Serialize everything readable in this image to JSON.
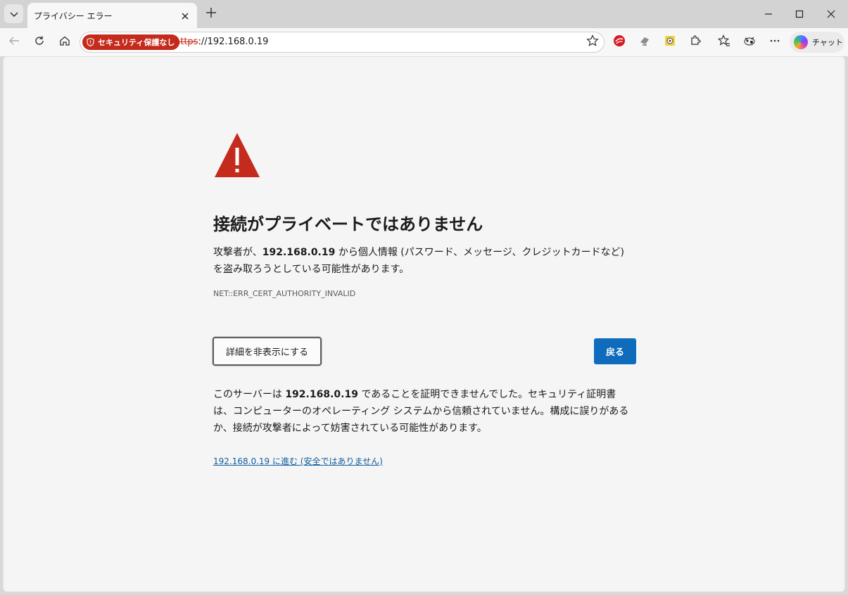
{
  "tab": {
    "title": "プライバシー エラー"
  },
  "omnibox": {
    "security_chip": "セキュリティ保護なし",
    "url_scheme": "https",
    "url_rest": "://192.168.0.19"
  },
  "toolbar": {
    "chat_label": "チャット"
  },
  "colors": {
    "danger": "#c42b1c",
    "primary": "#0f6cbd",
    "link": "#115ea3"
  },
  "error_page": {
    "heading": "接続がプライベートではありません",
    "desc_prefix": "攻撃者が、",
    "desc_host": "192.168.0.19",
    "desc_suffix": " から個人情報 (パスワード、メッセージ、クレジットカードなど) を盗み取ろうとしている可能性があります。",
    "error_code": "NET::ERR_CERT_AUTHORITY_INVALID",
    "details_button": "詳細を非表示にする",
    "back_button": "戻る",
    "explain_prefix": "このサーバーは ",
    "explain_host": "192.168.0.19",
    "explain_suffix": " であることを証明できませんでした。セキュリティ証明書は、コンピューターのオペレーティング システムから信頼されていません。構成に誤りがあるか、接続が攻撃者によって妨害されている可能性があります。",
    "proceed_link": "192.168.0.19 に進む (安全ではありません)"
  }
}
